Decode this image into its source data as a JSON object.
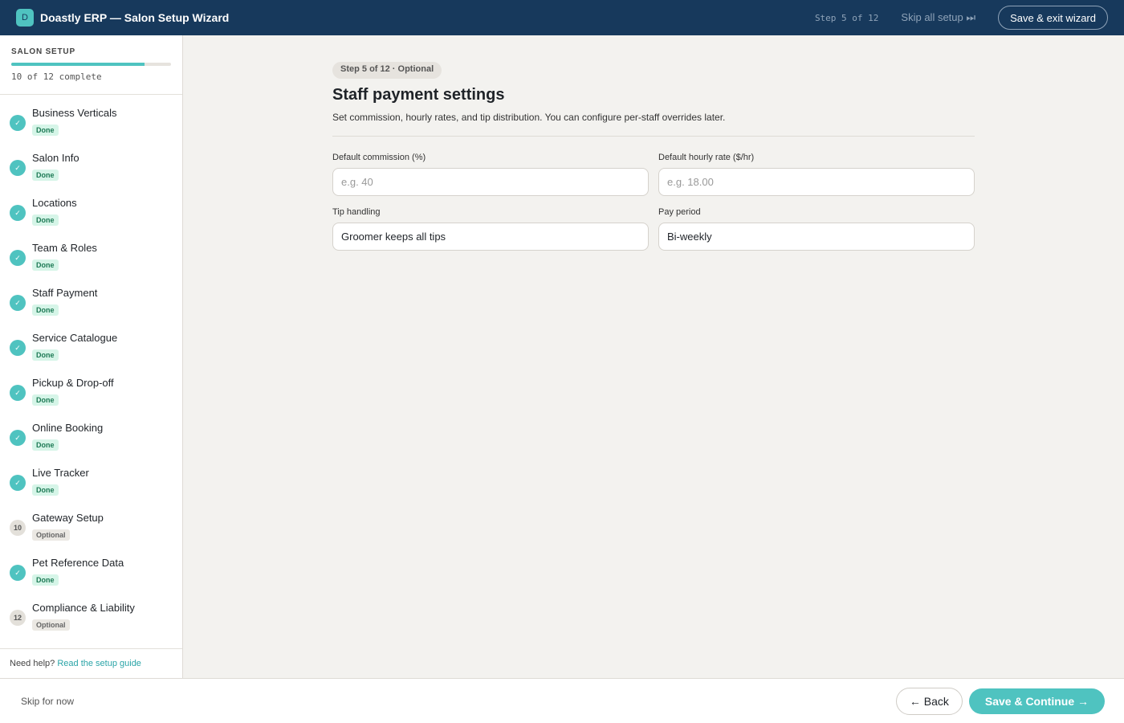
{
  "header": {
    "logo_letter": "D",
    "title": "Doastly ERP — Salon Setup Wizard",
    "step_counter": "Step 5 of 12",
    "skip_all_label": "Skip all setup ⏭",
    "save_exit_label": "Save & exit wizard"
  },
  "sidebar": {
    "title": "SALON SETUP",
    "progress_fraction": 0.833,
    "progress_text": "10 of 12 complete",
    "steps": [
      {
        "label": "Business Verticals",
        "status": "done",
        "badge": "Done",
        "icon": "✓"
      },
      {
        "label": "Salon Info",
        "status": "done",
        "badge": "Done",
        "icon": "✓"
      },
      {
        "label": "Locations",
        "status": "done",
        "badge": "Done",
        "icon": "✓"
      },
      {
        "label": "Team & Roles",
        "status": "done",
        "badge": "Done",
        "icon": "✓"
      },
      {
        "label": "Staff Payment",
        "status": "done",
        "badge": "Done",
        "icon": "✓"
      },
      {
        "label": "Service Catalogue",
        "status": "done",
        "badge": "Done",
        "icon": "✓"
      },
      {
        "label": "Pickup & Drop-off",
        "status": "done",
        "badge": "Done",
        "icon": "✓"
      },
      {
        "label": "Online Booking",
        "status": "done",
        "badge": "Done",
        "icon": "✓"
      },
      {
        "label": "Live Tracker",
        "status": "done",
        "badge": "Done",
        "icon": "✓"
      },
      {
        "label": "Gateway Setup",
        "status": "optional",
        "badge": "Optional",
        "icon": "10"
      },
      {
        "label": "Pet Reference Data",
        "status": "done",
        "badge": "Done",
        "icon": "✓"
      },
      {
        "label": "Compliance & Liability",
        "status": "optional",
        "badge": "Optional",
        "icon": "12"
      }
    ],
    "help_text": "Need help?",
    "help_link": "Read the setup guide"
  },
  "main": {
    "step_pill": "Step 5 of 12 · Optional",
    "title": "Staff payment settings",
    "subtitle": "Set commission, hourly rates, and tip distribution. You can configure per-staff overrides later.",
    "fields": {
      "commission": {
        "label": "Default commission (%)",
        "value": "",
        "placeholder": "e.g. 40"
      },
      "hourly_rate": {
        "label": "Default hourly rate ($/hr)",
        "value": "",
        "placeholder": "e.g. 18.00"
      },
      "tip_handling": {
        "label": "Tip handling",
        "value": "Groomer keeps all tips"
      },
      "pay_period": {
        "label": "Pay period",
        "value": "Bi-weekly"
      }
    }
  },
  "footer": {
    "skip_label": "Skip for now",
    "back_label": "← Back",
    "next_label": "Save & Continue →"
  },
  "colors": {
    "topbar": "#17395c",
    "accent": "#4fc3c0",
    "done_badge_bg": "#d6f5e8",
    "done_badge_text": "#1d7a55",
    "optional_badge_bg": "#ebe8e3",
    "page_bg": "#f3f2ef"
  }
}
